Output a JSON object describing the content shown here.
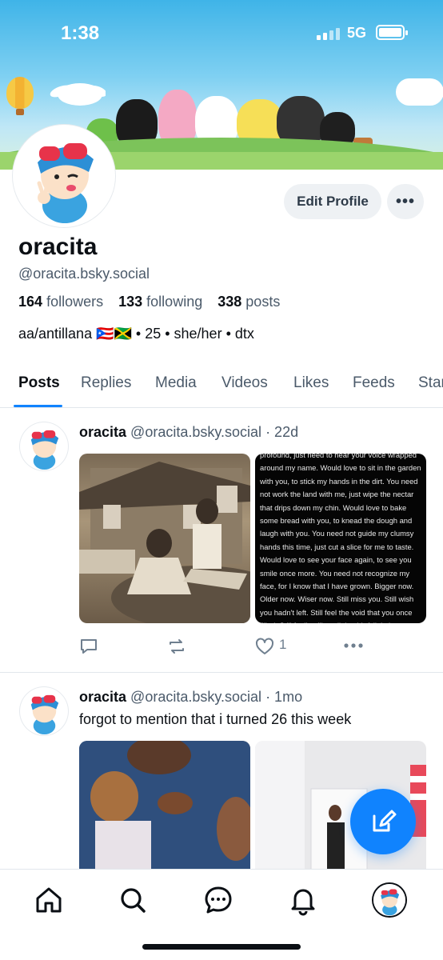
{
  "status_bar": {
    "time": "1:38",
    "network": "5G"
  },
  "profile": {
    "display_name": "oracita",
    "handle": "@oracita.bsky.social",
    "followers_count": "164",
    "followers_label": "followers",
    "following_count": "133",
    "following_label": "following",
    "posts_count": "338",
    "posts_label": "posts",
    "bio": "aa/antillana 🇵🇷🇯🇲 • 25 • she/her • dtx",
    "edit_button": "Edit Profile",
    "more_button": "•••"
  },
  "tabs": [
    {
      "label": "Posts"
    },
    {
      "label": "Replies"
    },
    {
      "label": "Media"
    },
    {
      "label": "Videos"
    },
    {
      "label": "Likes"
    },
    {
      "label": "Feeds"
    },
    {
      "label": "Starter Packs"
    }
  ],
  "posts": [
    {
      "author": "oracita",
      "handle": "@oracita.bsky.social",
      "time": "· 22d",
      "like_count": "1",
      "image_text": "profound, just need to hear your voice wrapped around my name. Would love to sit in the garden with you, to stick my hands in the dirt. You need not work the land with me, just wipe the nectar that drips down my chin. Would love to bake some bread with you, to knead the dough and laugh with you. You need not guide my clumsy hands this time, just cut a slice for me to taste. Would love to see your face again, to see you smile once more. You need not recognize my face, for I know that I have grown. Bigger now. Older now. Wiser now. Still miss you. Still wish you hadn't left. Still feel the void that you once filled. Still feeling like a little girl. A little lost now that you've moved on. A little scared now that I'm on my own. Miss you. Wish you'd guide my steps once more. And sing that tune you always sang"
    },
    {
      "author": "oracita",
      "handle": "@oracita.bsky.social",
      "time": "· 1mo",
      "text": "forgot to mention that i turned 26 this week"
    }
  ],
  "nav": {
    "items": [
      "home-icon",
      "search-icon",
      "chat-icon",
      "bell-icon",
      "profile-avatar"
    ]
  },
  "colors": {
    "accent": "#1083fe",
    "text": "#0b0f14",
    "muted": "#4b5a6a"
  }
}
